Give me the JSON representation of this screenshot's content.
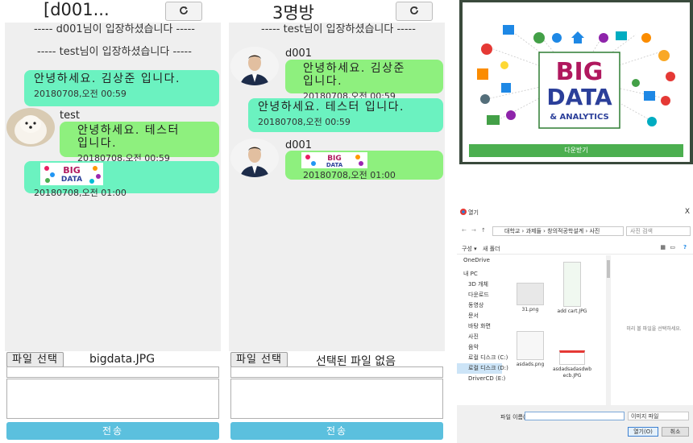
{
  "pane1": {
    "title": "[d001...",
    "system_messages": [
      "----- d001님이 입장하셨습니다 -----",
      "----- test님이 입장하셨습니다 -----"
    ],
    "messages": [
      {
        "text": "안녕하세요. 김상준 입니다.",
        "time": "20180708,오전 00:59"
      },
      {
        "user": "test",
        "text": "안녕하세요. 테스터 입니다.",
        "time": "20180708,오전 00:59"
      },
      {
        "image": "bigdata-thumbnail",
        "time": "20180708,오전 01:00"
      }
    ],
    "file_button": "파일 선택",
    "file_name": "bigdata.JPG",
    "send_button": "전송"
  },
  "pane2": {
    "title": "3명방",
    "system_messages": [
      "----- test님이 입장하셨습니다 -----"
    ],
    "messages": [
      {
        "user": "d001",
        "text": "안녕하세요. 김상준 입니다.",
        "time": "20180708,오전 00:59"
      },
      {
        "text": "안녕하세요. 테스터 입니다.",
        "time": "20180708,오전 00:59"
      },
      {
        "user": "d001",
        "image": "bigdata-thumbnail",
        "time": "20180708,오전 01:00"
      }
    ],
    "file_button": "파일 선택",
    "file_name": "선택된 파일 없음",
    "send_button": "전송"
  },
  "preview": {
    "big": "BIG",
    "data": "DATA",
    "analytics": "& ANALYTICS",
    "download_button": "다운받기"
  },
  "dialog": {
    "title": "열기",
    "close": "X",
    "breadcrumb": "대학교 › 과제들 › 창의적공학설계 › 사진",
    "search_placeholder": "사진 검색",
    "organize": "구성 ▾",
    "new_folder": "새 폴더",
    "nav": [
      "OneDrive",
      "내 PC",
      "3D 개체",
      "다운로드",
      "동영상",
      "문서",
      "바탕 화면",
      "사진",
      "음악",
      "로컬 디스크 (C:)",
      "로컬 디스크 (D:)",
      "DriverCD (E:)"
    ],
    "files": [
      "31.png",
      "add cart.JPG",
      "asdads.png",
      "asdadsadasdwb ecb.JPG"
    ],
    "preview_message": "미리 볼 파일을 선택하세요.",
    "filename_label": "파일 이름(N):",
    "filetype": "이미지 파일",
    "open_button": "열기(O)",
    "cancel_button": "취소"
  },
  "colors": {
    "my_bubble": "#6bf2c0",
    "their_bubble": "#8ef07e",
    "send_button": "#5bc0de",
    "download_button": "#4caf50"
  }
}
